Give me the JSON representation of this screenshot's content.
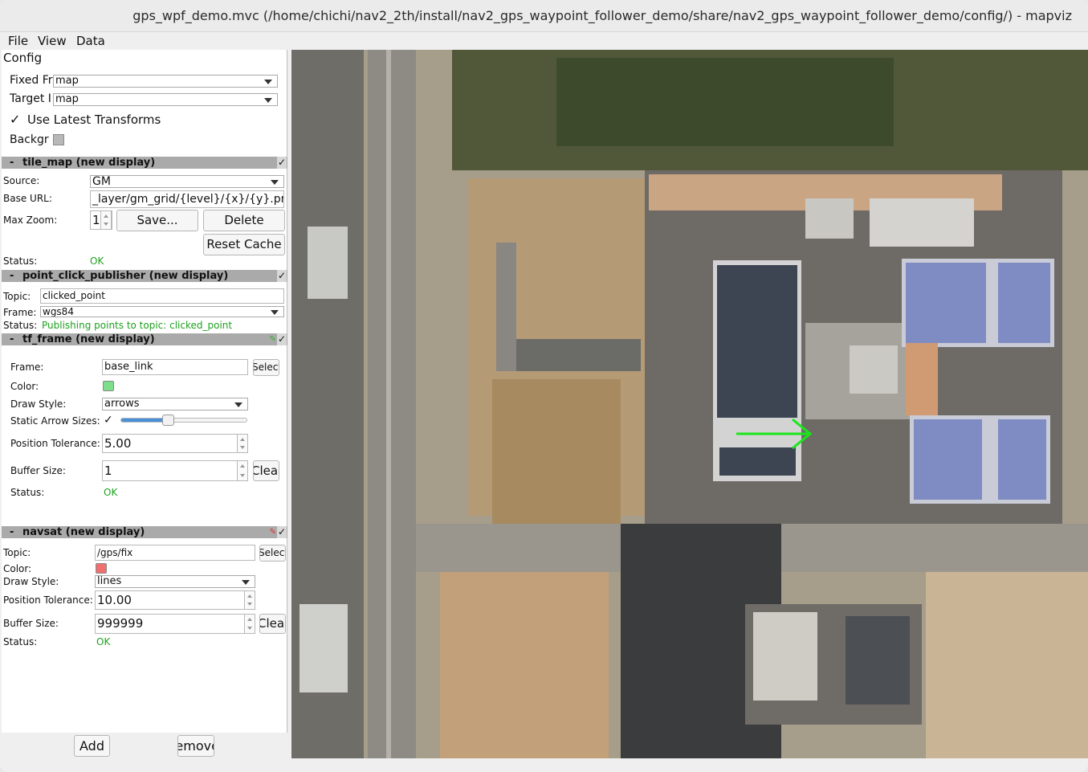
{
  "window": {
    "title": "gps_wpf_demo.mvc (/home/chichi/nav2_2th/install/nav2_gps_waypoint_follower_demo/share/nav2_gps_waypoint_follower_demo/config/) - mapviz"
  },
  "menu": [
    "File",
    "View",
    "Data"
  ],
  "config": {
    "header": "Config",
    "fixed_frame_label": "Fixed Fr",
    "fixed_frame_value": "map",
    "target_frame_label": "Target I",
    "target_frame_value": "map",
    "use_latest_transforms_label": "Use Latest Transforms",
    "use_latest_transforms_checked": "✓",
    "background_label": "Backgr"
  },
  "tile_map": {
    "header": "tile_map (new display)",
    "enabled": "✓",
    "source_label": "Source:",
    "source_value": "GM",
    "base_url_label": "Base URL:",
    "base_url_value": "_layer/gm_grid/{level}/{x}/{y}.png",
    "max_zoom_label": "Max Zoom:",
    "max_zoom_value": "1",
    "save_button": "Save...",
    "delete_button": "Delete",
    "reset_cache_button": "Reset Cache",
    "status_label": "Status:",
    "status_value": "OK"
  },
  "point_click_publisher": {
    "header": "point_click_publisher (new display)",
    "enabled": "✓",
    "topic_label": "Topic:",
    "topic_value": "clicked_point",
    "frame_label": "Frame:",
    "frame_value": "wgs84",
    "status_label": "Status:",
    "status_value": "Publishing points to topic: clicked_point"
  },
  "tf_frame": {
    "header": "tf_frame (new display)",
    "enabled": "✓",
    "frame_label": "Frame:",
    "frame_value": "base_link",
    "select_button": "Select",
    "color_label": "Color:",
    "color": "#7ddf8a",
    "draw_style_label": "Draw Style:",
    "draw_style_value": "arrows",
    "static_arrow_label": "Static Arrow Sizes:",
    "static_arrow_checked": "✓",
    "arrow_size_slider": 0.34,
    "position_tolerance_label": "Position Tolerance:",
    "position_tolerance_value": "5.00",
    "buffer_size_label": "Buffer Size:",
    "buffer_size_value": "1",
    "clear_button": "Clear",
    "status_label": "Status:",
    "status_value": "OK"
  },
  "navsat": {
    "header": "navsat (new display)",
    "enabled": "✓",
    "topic_label": "Topic:",
    "topic_value": "/gps/fix",
    "select_button": "Select",
    "color_label": "Color:",
    "color": "#f07070",
    "draw_style_label": "Draw Style:",
    "draw_style_value": "lines",
    "position_tolerance_label": "Position Tolerance:",
    "position_tolerance_value": "10.00",
    "buffer_size_label": "Buffer Size:",
    "buffer_size_value": "999999",
    "clear_button": "Clear",
    "status_label": "Status:",
    "status_value": "OK"
  },
  "bottom": {
    "add_button": "Add",
    "remove_button": "Remove"
  },
  "map": {
    "robot_arrow_color": "#19e619"
  }
}
